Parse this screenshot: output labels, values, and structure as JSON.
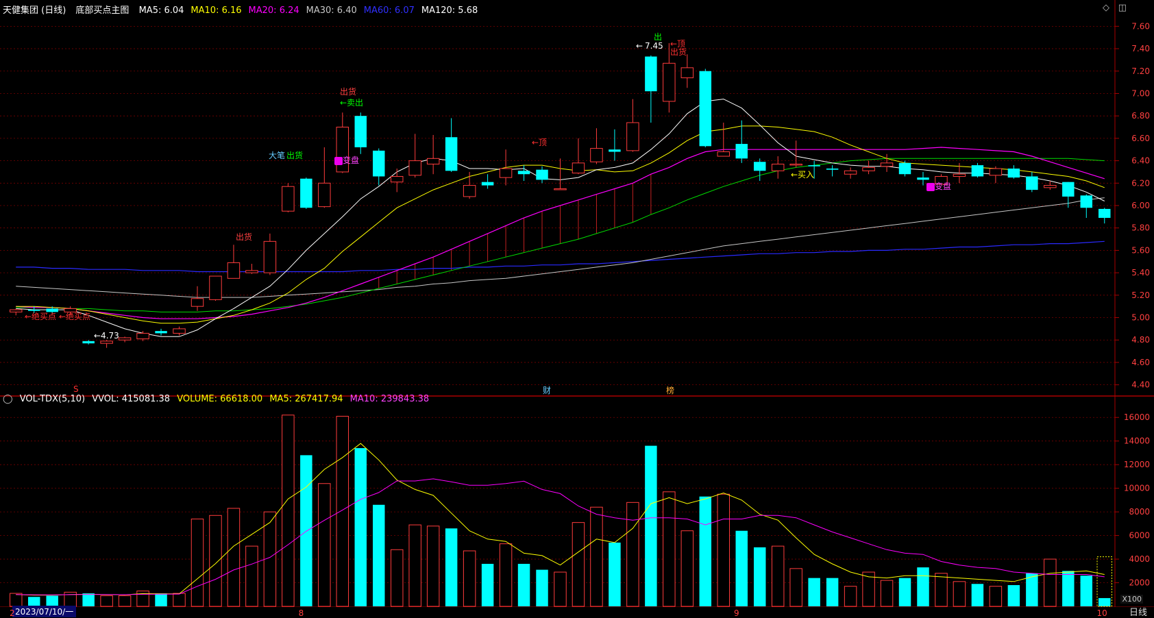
{
  "header": {
    "stock": "天健集团 (日线)",
    "indicator": "底部买点主图",
    "ma": [
      {
        "label": "MA5: 6.04",
        "color": "#ffffff"
      },
      {
        "label": "MA10: 6.16",
        "color": "#ffff00"
      },
      {
        "label": "MA20: 6.24",
        "color": "#ff00ff"
      },
      {
        "label": "MA30: 6.40",
        "color": "#c8c8c8"
      },
      {
        "label": "MA60: 6.07",
        "color": "#3030ff"
      },
      {
        "label": "MA120: 5.68",
        "color": "#ffffff"
      }
    ]
  },
  "volume_header": {
    "title": "VOL-TDX(5,10)",
    "vvol": "VVOL: 415081.38",
    "volume": "VOLUME: 66618.00",
    "ma5": "MA5: 267417.94",
    "ma10": "MA10: 239843.38"
  },
  "window_icons": {
    "diamond": "◇",
    "restore": "◫"
  },
  "annotations": {
    "buy_point_1": "←绝买点",
    "buy_point_2": "←绝买点",
    "low_price": "←4.73",
    "high_price": "7.45",
    "high_arrow": "←",
    "top_1": "←顶",
    "top_2": "←顶",
    "ship_1": "出货",
    "ship_2": "出货",
    "ship_3": "出货",
    "ship_4": "出货",
    "out": "出",
    "sell": "←卖出",
    "big_pen": "大笔",
    "change_1": "变盘",
    "change_2": "变盘",
    "buy_in": "←买入"
  },
  "markers": {
    "s": "S",
    "cai": "财",
    "bang": "榜"
  },
  "footer": {
    "date": "2023/07/10/一",
    "period": "日线",
    "x100": "X100"
  },
  "month_ticks": [
    "2",
    "8",
    "9",
    "10"
  ],
  "colors": {
    "up": "#ff3c3c",
    "down": "#00ffff",
    "grid": "#7a0000",
    "axis_text": "#ff4040"
  },
  "chart_data": [
    {
      "type": "candlestick",
      "title": "天健集团 (日线)",
      "ylim": [
        4.3,
        7.7
      ],
      "yticks": [
        4.4,
        4.6,
        4.8,
        5.0,
        5.2,
        5.4,
        5.6,
        5.8,
        6.0,
        6.2,
        6.4,
        6.6,
        6.8,
        7.0,
        7.2,
        7.4,
        7.6
      ],
      "candles": [
        {
          "o": 5.05,
          "h": 5.08,
          "l": 5.02,
          "c": 5.07
        },
        {
          "o": 5.07,
          "h": 5.1,
          "l": 5.04,
          "c": 5.06
        },
        {
          "o": 5.08,
          "h": 5.1,
          "l": 5.03,
          "c": 5.05
        },
        {
          "o": 5.05,
          "h": 5.1,
          "l": 5.02,
          "c": 5.08
        },
        {
          "o": 4.79,
          "h": 4.8,
          "l": 4.76,
          "c": 4.77
        },
        {
          "o": 4.77,
          "h": 4.8,
          "l": 4.73,
          "c": 4.79
        },
        {
          "o": 4.8,
          "h": 4.83,
          "l": 4.78,
          "c": 4.82
        },
        {
          "o": 4.81,
          "h": 4.88,
          "l": 4.79,
          "c": 4.86
        },
        {
          "o": 4.88,
          "h": 4.9,
          "l": 4.84,
          "c": 4.86
        },
        {
          "o": 4.86,
          "h": 4.92,
          "l": 4.84,
          "c": 4.9
        },
        {
          "o": 5.1,
          "h": 5.28,
          "l": 5.06,
          "c": 5.17
        },
        {
          "o": 5.16,
          "h": 5.37,
          "l": 5.15,
          "c": 5.37
        },
        {
          "o": 5.35,
          "h": 5.65,
          "l": 5.35,
          "c": 5.49
        },
        {
          "o": 5.4,
          "h": 5.48,
          "l": 5.39,
          "c": 5.42
        },
        {
          "o": 5.4,
          "h": 5.75,
          "l": 5.38,
          "c": 5.68
        },
        {
          "o": 5.95,
          "h": 6.2,
          "l": 5.94,
          "c": 6.17
        },
        {
          "o": 6.24,
          "h": 6.25,
          "l": 5.97,
          "c": 5.98
        },
        {
          "o": 5.99,
          "h": 6.52,
          "l": 5.98,
          "c": 6.2
        },
        {
          "o": 6.3,
          "h": 6.83,
          "l": 6.29,
          "c": 6.7
        },
        {
          "o": 6.8,
          "h": 6.83,
          "l": 6.46,
          "c": 6.52
        },
        {
          "o": 6.49,
          "h": 6.51,
          "l": 6.18,
          "c": 6.26
        },
        {
          "o": 6.21,
          "h": 6.33,
          "l": 6.12,
          "c": 6.26
        },
        {
          "o": 6.27,
          "h": 6.64,
          "l": 6.25,
          "c": 6.4
        },
        {
          "o": 6.37,
          "h": 6.63,
          "l": 6.28,
          "c": 6.42
        },
        {
          "o": 6.61,
          "h": 6.78,
          "l": 6.3,
          "c": 6.31
        },
        {
          "o": 6.08,
          "h": 6.3,
          "l": 6.06,
          "c": 6.18
        },
        {
          "o": 6.21,
          "h": 6.28,
          "l": 6.15,
          "c": 6.18
        },
        {
          "o": 6.25,
          "h": 6.5,
          "l": 6.18,
          "c": 6.33
        },
        {
          "o": 6.31,
          "h": 6.36,
          "l": 6.22,
          "c": 6.28
        },
        {
          "o": 6.32,
          "h": 6.35,
          "l": 6.2,
          "c": 6.23
        },
        {
          "o": 6.15,
          "h": 6.42,
          "l": 6.14,
          "c": 6.15
        },
        {
          "o": 6.29,
          "h": 6.6,
          "l": 6.28,
          "c": 6.38
        },
        {
          "o": 6.39,
          "h": 6.69,
          "l": 6.37,
          "c": 6.51
        },
        {
          "o": 6.5,
          "h": 6.68,
          "l": 6.4,
          "c": 6.48
        },
        {
          "o": 6.49,
          "h": 6.95,
          "l": 6.48,
          "c": 6.74
        },
        {
          "o": 7.33,
          "h": 7.34,
          "l": 6.74,
          "c": 7.02
        },
        {
          "o": 6.93,
          "h": 7.45,
          "l": 6.83,
          "c": 7.27
        },
        {
          "o": 7.14,
          "h": 7.35,
          "l": 7.05,
          "c": 7.23
        },
        {
          "o": 7.2,
          "h": 7.22,
          "l": 6.52,
          "c": 6.53
        },
        {
          "o": 6.44,
          "h": 6.74,
          "l": 6.44,
          "c": 6.48
        },
        {
          "o": 6.55,
          "h": 6.76,
          "l": 6.38,
          "c": 6.42
        },
        {
          "o": 6.39,
          "h": 6.42,
          "l": 6.22,
          "c": 6.31
        },
        {
          "o": 6.31,
          "h": 6.44,
          "l": 6.24,
          "c": 6.37
        },
        {
          "o": 6.37,
          "h": 6.58,
          "l": 6.34,
          "c": 6.37
        },
        {
          "o": 6.36,
          "h": 6.4,
          "l": 6.24,
          "c": 6.35
        },
        {
          "o": 6.33,
          "h": 6.36,
          "l": 6.26,
          "c": 6.32
        },
        {
          "o": 6.28,
          "h": 6.34,
          "l": 6.24,
          "c": 6.31
        },
        {
          "o": 6.31,
          "h": 6.4,
          "l": 6.28,
          "c": 6.34
        },
        {
          "o": 6.35,
          "h": 6.46,
          "l": 6.3,
          "c": 6.38
        },
        {
          "o": 6.38,
          "h": 6.4,
          "l": 6.26,
          "c": 6.28
        },
        {
          "o": 6.25,
          "h": 6.3,
          "l": 6.18,
          "c": 6.23
        },
        {
          "o": 6.19,
          "h": 6.28,
          "l": 6.18,
          "c": 6.26
        },
        {
          "o": 6.26,
          "h": 6.38,
          "l": 6.2,
          "c": 6.28
        },
        {
          "o": 6.36,
          "h": 6.38,
          "l": 6.25,
          "c": 6.26
        },
        {
          "o": 6.27,
          "h": 6.35,
          "l": 6.2,
          "c": 6.33
        },
        {
          "o": 6.33,
          "h": 6.36,
          "l": 6.24,
          "c": 6.25
        },
        {
          "o": 6.26,
          "h": 6.3,
          "l": 6.12,
          "c": 6.14
        },
        {
          "o": 6.16,
          "h": 6.22,
          "l": 6.14,
          "c": 6.18
        },
        {
          "o": 6.21,
          "h": 6.21,
          "l": 5.98,
          "c": 6.08
        },
        {
          "o": 6.09,
          "h": 6.1,
          "l": 5.89,
          "c": 5.98
        },
        {
          "o": 5.97,
          "h": 5.98,
          "l": 5.84,
          "c": 5.89
        }
      ],
      "ma5": [
        5.08,
        5.07,
        5.07,
        5.07,
        5.02,
        4.96,
        4.9,
        4.86,
        4.83,
        4.83,
        4.89,
        4.99,
        5.08,
        5.18,
        5.28,
        5.43,
        5.6,
        5.75,
        5.9,
        6.06,
        6.17,
        6.3,
        6.38,
        6.42,
        6.4,
        6.33,
        6.33,
        6.32,
        6.33,
        6.24,
        6.23,
        6.25,
        6.32,
        6.34,
        6.38,
        6.5,
        6.64,
        6.82,
        6.93,
        6.95,
        6.87,
        6.72,
        6.56,
        6.44,
        6.41,
        6.38,
        6.36,
        6.35,
        6.35,
        6.33,
        6.32,
        6.3,
        6.29,
        6.29,
        6.28,
        6.27,
        6.25,
        6.22,
        6.18,
        6.12,
        6.04
      ],
      "ma10": [
        5.1,
        5.1,
        5.09,
        5.08,
        5.06,
        5.03,
        5.0,
        4.97,
        4.95,
        4.95,
        4.96,
        4.99,
        5.02,
        5.07,
        5.13,
        5.22,
        5.34,
        5.44,
        5.59,
        5.72,
        5.85,
        5.98,
        6.06,
        6.14,
        6.2,
        6.26,
        6.3,
        6.34,
        6.36,
        6.36,
        6.33,
        6.31,
        6.32,
        6.3,
        6.31,
        6.38,
        6.47,
        6.58,
        6.66,
        6.68,
        6.71,
        6.71,
        6.7,
        6.68,
        6.66,
        6.61,
        6.54,
        6.48,
        6.42,
        6.38,
        6.37,
        6.36,
        6.35,
        6.34,
        6.33,
        6.32,
        6.3,
        6.28,
        6.26,
        6.22,
        6.16
      ],
      "ma20": [
        5.1,
        5.09,
        5.09,
        5.08,
        5.06,
        5.04,
        5.02,
        5.0,
        4.99,
        4.99,
        4.99,
        5.0,
        5.01,
        5.03,
        5.06,
        5.09,
        5.13,
        5.18,
        5.24,
        5.3,
        5.36,
        5.42,
        5.48,
        5.54,
        5.61,
        5.68,
        5.75,
        5.82,
        5.89,
        5.95,
        6.0,
        6.05,
        6.1,
        6.15,
        6.2,
        6.28,
        6.34,
        6.42,
        6.48,
        6.5,
        6.5,
        6.5,
        6.5,
        6.5,
        6.5,
        6.5,
        6.5,
        6.5,
        6.5,
        6.5,
        6.51,
        6.52,
        6.51,
        6.5,
        6.49,
        6.48,
        6.44,
        6.39,
        6.34,
        6.29,
        6.24
      ],
      "ma30": [
        5.09,
        5.09,
        5.09,
        5.08,
        5.08,
        5.07,
        5.06,
        5.06,
        5.05,
        5.05,
        5.05,
        5.06,
        5.06,
        5.07,
        5.08,
        5.1,
        5.12,
        5.15,
        5.18,
        5.22,
        5.26,
        5.3,
        5.34,
        5.38,
        5.42,
        5.46,
        5.5,
        5.54,
        5.58,
        5.62,
        5.66,
        5.7,
        5.75,
        5.8,
        5.85,
        5.92,
        5.98,
        6.05,
        6.11,
        6.17,
        6.22,
        6.27,
        6.31,
        6.34,
        6.36,
        6.38,
        6.4,
        6.41,
        6.42,
        6.42,
        6.42,
        6.42,
        6.42,
        6.42,
        6.42,
        6.42,
        6.42,
        6.42,
        6.42,
        6.41,
        6.4
      ],
      "ma60": [
        5.28,
        5.27,
        5.26,
        5.25,
        5.24,
        5.23,
        5.22,
        5.21,
        5.2,
        5.19,
        5.18,
        5.18,
        5.18,
        5.18,
        5.19,
        5.2,
        5.21,
        5.22,
        5.23,
        5.24,
        5.25,
        5.27,
        5.28,
        5.3,
        5.31,
        5.33,
        5.34,
        5.35,
        5.37,
        5.39,
        5.41,
        5.43,
        5.45,
        5.47,
        5.49,
        5.52,
        5.55,
        5.58,
        5.61,
        5.64,
        5.66,
        5.68,
        5.7,
        5.72,
        5.74,
        5.76,
        5.78,
        5.8,
        5.82,
        5.84,
        5.86,
        5.88,
        5.9,
        5.92,
        5.94,
        5.96,
        5.98,
        6.0,
        6.02,
        6.05,
        6.07
      ],
      "ma120": [
        5.45,
        5.45,
        5.44,
        5.44,
        5.43,
        5.43,
        5.43,
        5.42,
        5.42,
        5.42,
        5.41,
        5.41,
        5.41,
        5.41,
        5.41,
        5.41,
        5.41,
        5.41,
        5.41,
        5.42,
        5.42,
        5.43,
        5.43,
        5.44,
        5.44,
        5.45,
        5.45,
        5.46,
        5.46,
        5.47,
        5.47,
        5.48,
        5.48,
        5.49,
        5.5,
        5.51,
        5.52,
        5.53,
        5.54,
        5.55,
        5.56,
        5.57,
        5.57,
        5.58,
        5.58,
        5.59,
        5.59,
        5.6,
        5.6,
        5.61,
        5.61,
        5.62,
        5.63,
        5.63,
        5.64,
        5.65,
        5.65,
        5.66,
        5.66,
        5.67,
        5.68
      ]
    },
    {
      "type": "bar",
      "title": "VOL-TDX(5,10)",
      "ylim": [
        0,
        17000
      ],
      "yticks": [
        2000,
        4000,
        6000,
        8000,
        10000,
        12000,
        14000,
        16000
      ],
      "volume": [
        1100,
        800,
        900,
        1200,
        1100,
        900,
        900,
        1300,
        1100,
        1100,
        7400,
        7700,
        8300,
        5100,
        8000,
        16200,
        12800,
        10400,
        16100,
        13400,
        8600,
        4800,
        6900,
        6800,
        6600,
        4700,
        3600,
        5300,
        3600,
        3100,
        2900,
        7100,
        8400,
        5400,
        8800,
        13600,
        9700,
        6400,
        9300,
        9500,
        6400,
        5000,
        5100,
        3200,
        2400,
        2400,
        1700,
        2900,
        2200,
        2400,
        3300,
        2800,
        2100,
        1900,
        1700,
        1800,
        2800,
        4000,
        3000,
        2600,
        700
      ],
      "vol_ma5": [
        1000,
        950,
        950,
        1000,
        1020,
        1000,
        980,
        1080,
        1060,
        1060,
        2340,
        3620,
        5100,
        6100,
        7100,
        9100,
        10100,
        11600,
        12600,
        13800,
        12400,
        10700,
        9900,
        9400,
        7900,
        6400,
        5700,
        5500,
        4500,
        4300,
        3500,
        4600,
        5700,
        5400,
        6600,
        8700,
        9200,
        8700,
        9100,
        9600,
        9000,
        7800,
        7300,
        5800,
        4400,
        3600,
        2900,
        2500,
        2400,
        2600,
        2600,
        2500,
        2400,
        2300,
        2200,
        2100,
        2500,
        2800,
        2900,
        3000,
        2700
      ],
      "vol_ma10": [
        1000,
        980,
        970,
        990,
        1010,
        1000,
        990,
        1020,
        1030,
        1040,
        1700,
        2290,
        3080,
        3580,
        4150,
        5220,
        6360,
        7290,
        8160,
        9060,
        9640,
        10620,
        10620,
        10800,
        10550,
        10250,
        10250,
        10400,
        10600,
        9900,
        9550,
        8500,
        7800,
        7500,
        7300,
        7500,
        7500,
        7400,
        6900,
        7400,
        7400,
        7700,
        7700,
        7500,
        6900,
        6300,
        5800,
        5300,
        4800,
        4500,
        4400,
        3800,
        3500,
        3300,
        3200,
        2900,
        2800,
        2700,
        2700,
        2700,
        2500
      ]
    }
  ]
}
